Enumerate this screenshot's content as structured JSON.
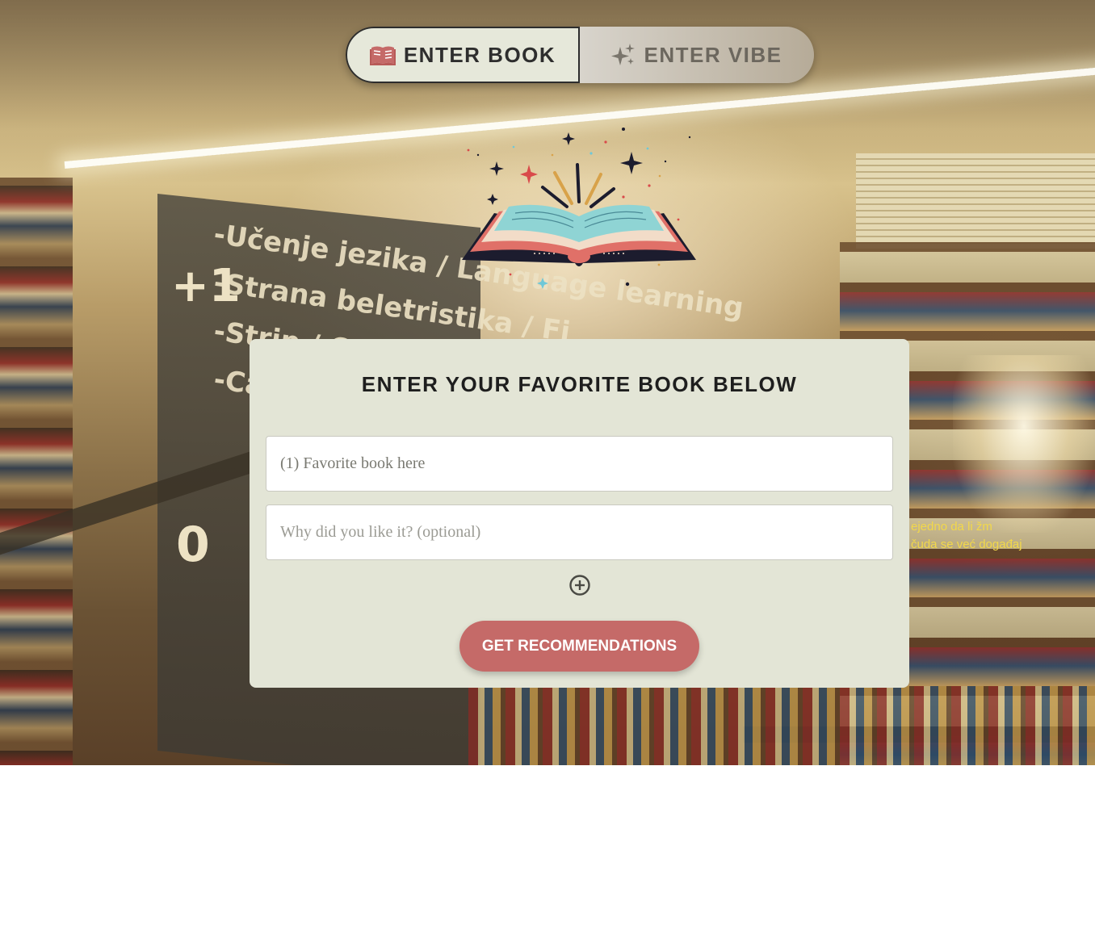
{
  "toggle": {
    "book_label": "ENTER BOOK",
    "book_icon": "open-book-icon",
    "vibe_label": "ENTER VIBE",
    "vibe_icon": "sparkles-icon",
    "active": "book"
  },
  "logo": {
    "icon": "open-book-sparkles-logo"
  },
  "form": {
    "title": "ENTER YOUR FAVORITE BOOK BELOW",
    "book_placeholder": "(1) Favorite book here",
    "reason_placeholder": "Why did you like it? (optional)",
    "add_icon": "plus-circle-icon",
    "submit_label": "GET RECOMMENDATIONS"
  },
  "background": {
    "sign_lines": [
      "-Učenje jezika / Language learning",
      "-Strana beletristika / Fi",
      "-Strip / C",
      "-Ca"
    ],
    "sign_numbers": [
      "+1",
      "0"
    ],
    "yellow_lines": [
      "ejedno da li žm",
      "čuda se već događaj"
    ]
  },
  "colors": {
    "card_bg": "#e3e5d6",
    "submit_bg": "#c56a68",
    "book_icon": "#c56a68",
    "vibe_icon": "#7a756c"
  }
}
